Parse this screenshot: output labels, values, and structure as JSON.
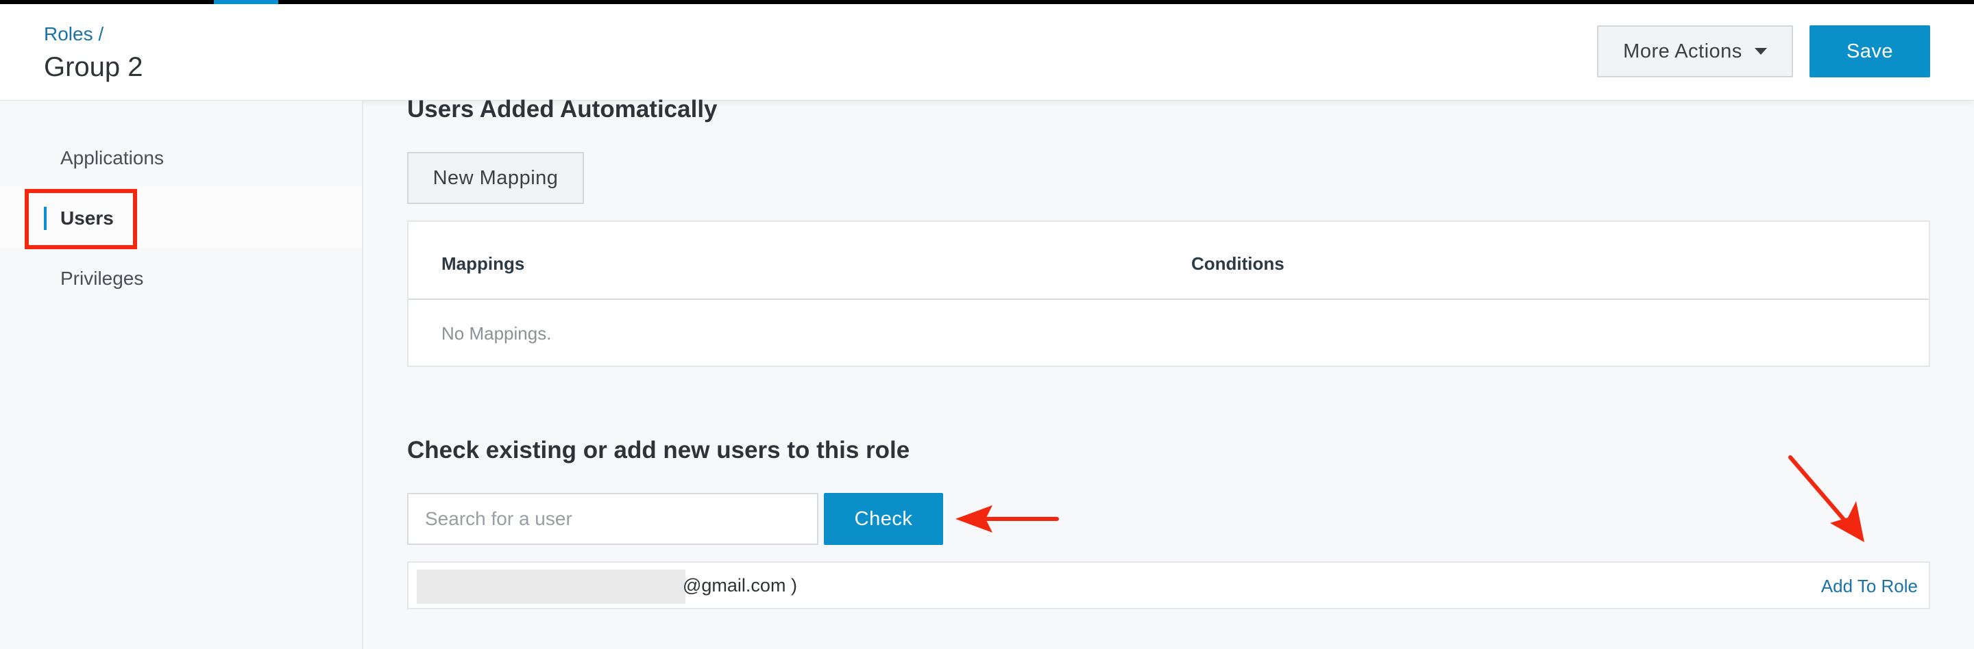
{
  "header": {
    "breadcrumb": "Roles /",
    "title": "Group 2",
    "more_actions_label": "More Actions",
    "save_label": "Save"
  },
  "sidebar": {
    "items": [
      {
        "label": "Applications",
        "active": false
      },
      {
        "label": "Users",
        "active": true
      },
      {
        "label": "Privileges",
        "active": false
      }
    ]
  },
  "main": {
    "auto_section_title": "Users Added Automatically",
    "new_mapping_label": "New Mapping",
    "table": {
      "columns": [
        "Mappings",
        "Conditions"
      ],
      "empty_text": "No Mappings."
    },
    "check_section_title": "Check existing or add new users to this role",
    "search": {
      "placeholder": "Search for a user",
      "value": ""
    },
    "check_label": "Check",
    "result": {
      "email_suffix": "@gmail.com )",
      "action_label": "Add To Role"
    }
  },
  "colors": {
    "accent": "#0a8fc8",
    "link": "#1a72a6",
    "annotation": "#f2270f"
  }
}
